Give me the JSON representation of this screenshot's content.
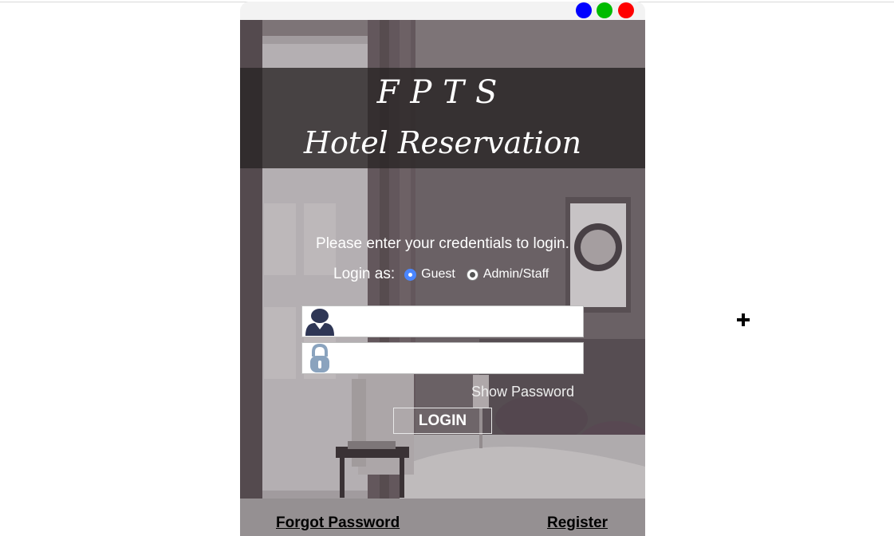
{
  "window": {
    "controls": [
      {
        "name": "minimize",
        "color": "#0000ff"
      },
      {
        "name": "maximize",
        "color": "#00bb00"
      },
      {
        "name": "close",
        "color": "#ff0000"
      }
    ]
  },
  "header": {
    "brand": "FPTS",
    "subtitle": "Hotel Reservation"
  },
  "form": {
    "prompt": "Please enter your credentials to login.",
    "login_as_label": "Login as:",
    "roles": [
      {
        "label": "Guest",
        "selected": true
      },
      {
        "label": "Admin/Staff",
        "selected": false
      }
    ],
    "username_icon": "user-icon",
    "username_value": "",
    "password_icon": "lock-icon",
    "password_value": "",
    "show_password_label": "Show Password",
    "login_button_label": "LOGIN"
  },
  "footer": {
    "forgot_password": "Forgot Password",
    "register": "Register"
  },
  "cursor": {
    "icon": "crosshair-move-icon"
  }
}
